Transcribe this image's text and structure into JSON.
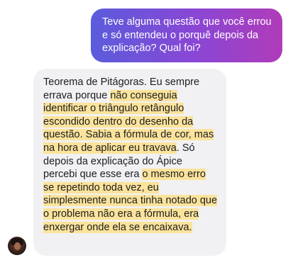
{
  "messages": {
    "user": {
      "text": "Teve alguma questão que você errou e só entendeu o porquê depois da explicação? Qual foi?"
    },
    "reply": {
      "segments": [
        {
          "text": "Teorema de Pitágoras. Eu sempre errava porque ",
          "highlight": false
        },
        {
          "text": "não conseguia identificar o triângulo retângulo escondido dentro do desenho da questão. Sabia a fórmula de cor, mas na hora de aplicar eu travava",
          "highlight": true
        },
        {
          "text": ". Só depois da explicação do Ápice percebi que esse era ",
          "highlight": false
        },
        {
          "text": "o mesmo erro se repetindo toda vez, eu simplesmente nunca tinha notado que o problema não era a fórmula, era enxergar onde ela se encaixava.",
          "highlight": true
        }
      ]
    }
  },
  "colors": {
    "highlight": "#fbe39b",
    "bubble_gradient_start": "#5b5cdc",
    "bubble_gradient_end": "#b03cb9",
    "reply_bubble": "#f1f1f3"
  },
  "icons": {
    "avatar": "user-avatar-photo"
  }
}
